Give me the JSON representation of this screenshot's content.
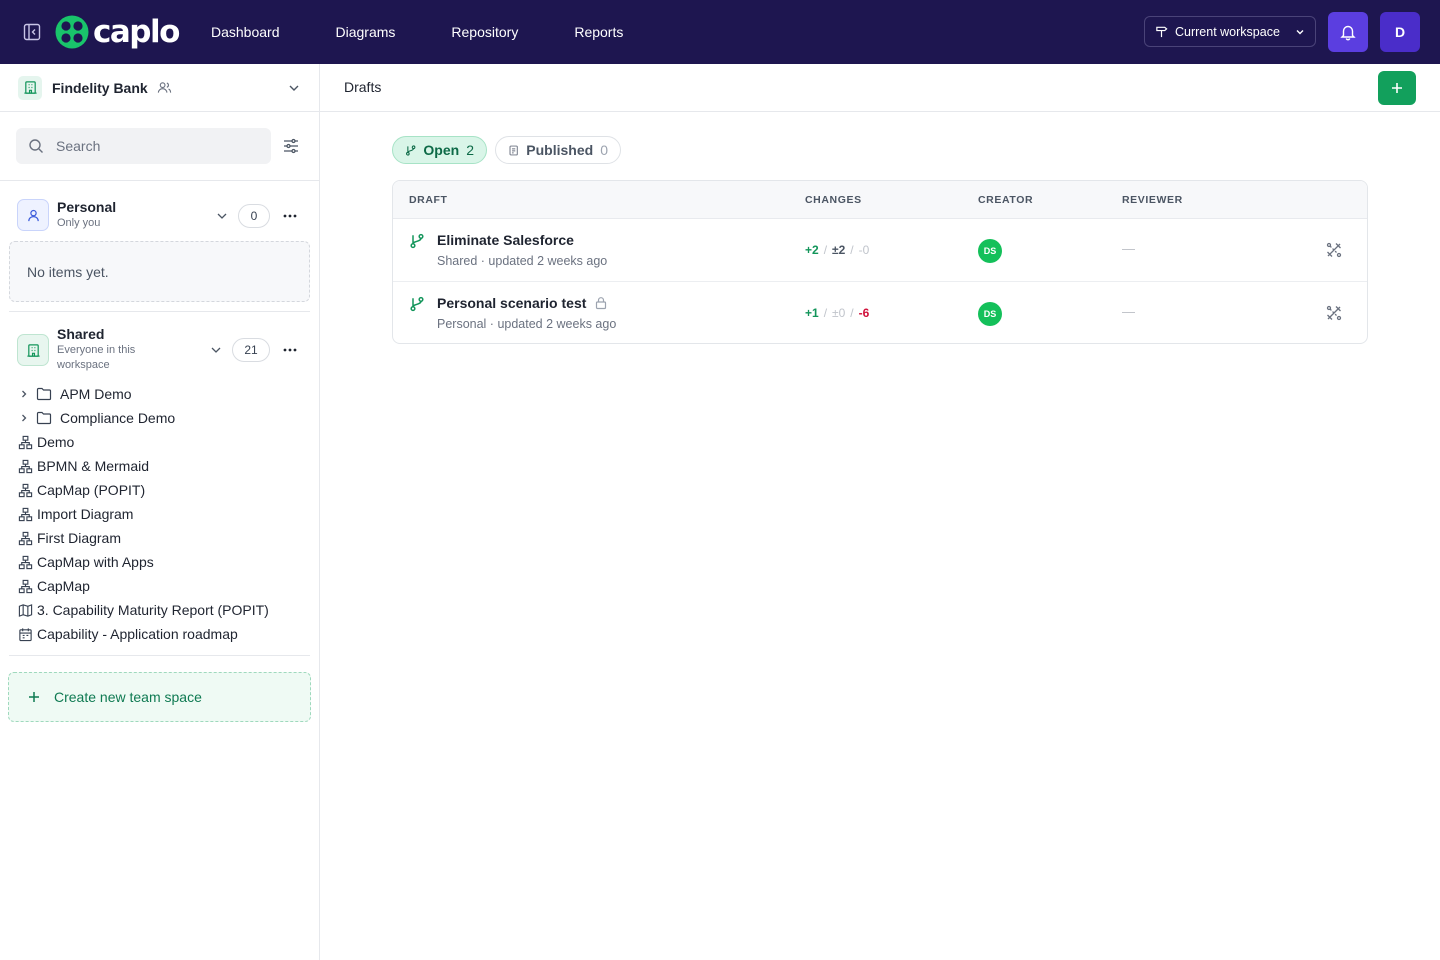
{
  "app": {
    "logo_text": "caplo",
    "nav": [
      "Dashboard",
      "Diagrams",
      "Repository",
      "Reports"
    ],
    "workspace_select": "Current workspace",
    "user_initial": "D"
  },
  "sidebar": {
    "org_name": "Findelity Bank",
    "search_placeholder": "Search",
    "personal": {
      "title": "Personal",
      "subtitle": "Only you",
      "count": "0",
      "empty_text": "No items yet."
    },
    "shared": {
      "title": "Shared",
      "subtitle": "Everyone in this workspace",
      "count": "21"
    },
    "tree": [
      {
        "label": "APM Demo",
        "kind": "folder"
      },
      {
        "label": "Compliance Demo",
        "kind": "folder"
      },
      {
        "label": "Demo",
        "kind": "diagram"
      },
      {
        "label": "BPMN & Mermaid",
        "kind": "diagram"
      },
      {
        "label": "CapMap (POPIT)",
        "kind": "diagram"
      },
      {
        "label": "Import Diagram",
        "kind": "diagram"
      },
      {
        "label": "First Diagram",
        "kind": "diagram"
      },
      {
        "label": "CapMap with Apps",
        "kind": "diagram"
      },
      {
        "label": "CapMap",
        "kind": "diagram"
      },
      {
        "label": "3. Capability Maturity Report (POPIT)",
        "kind": "map"
      },
      {
        "label": "Capability - Application roadmap",
        "kind": "calendar"
      }
    ],
    "create_space": "Create new team space"
  },
  "main": {
    "title": "Drafts",
    "tabs": [
      {
        "label": "Open",
        "count": "2"
      },
      {
        "label": "Published",
        "count": "0"
      }
    ],
    "columns": [
      "DRAFT",
      "CHANGES",
      "CREATOR",
      "REVIEWER"
    ],
    "rows": [
      {
        "title": "Eliminate Salesforce",
        "subtitle": "Shared · updated 2 weeks ago",
        "added": "+2",
        "modified": "±2",
        "deleted": "-0",
        "creator": "DS",
        "reviewer": "—",
        "locked": false
      },
      {
        "title": "Personal scenario test",
        "subtitle": "Personal · updated 2 weeks ago",
        "added": "+1",
        "modified": "±0",
        "deleted": "-6",
        "creator": "DS",
        "reviewer": "—",
        "locked": true
      }
    ]
  },
  "colors": {
    "topbar": "#1e1650",
    "accent_green": "#12a05c",
    "bell_purple": "#5b3ee0",
    "delete_red": "#d0103a"
  }
}
